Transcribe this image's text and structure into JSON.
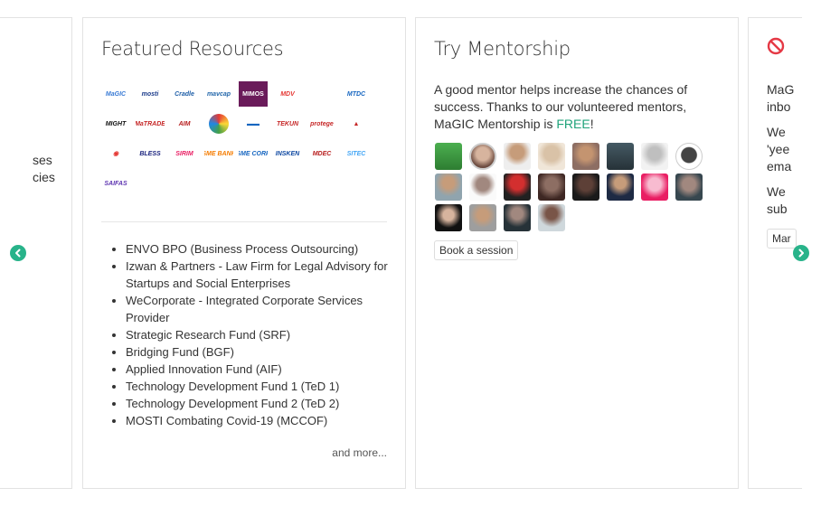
{
  "left_card": {
    "lines": [
      "ses",
      "cies"
    ]
  },
  "resources": {
    "title": "Featured Resources",
    "logos": [
      "MaGIC",
      "mosti",
      "Cradle",
      "mavcap",
      "MIMOS",
      "MDV",
      "",
      "MTDC",
      "MIGHT",
      "MaTRADE",
      "AIM",
      "",
      "",
      "TEKUN",
      "protege",
      "",
      "",
      "BLESS",
      "SIRIM",
      "SME BANK",
      "SME CORP",
      "INSKEN",
      "MDEC",
      "SITEC",
      "SAIFAS"
    ],
    "items": [
      "ENVO BPO (Business Process Outsourcing)",
      "Izwan & Partners - Law Firm for Legal Advisory for Startups and Social Enterprises",
      "WeCorporate - Integrated Corporate Services Provider",
      "Strategic Research Fund (SRF)",
      "Bridging Fund (BGF)",
      "Applied Innovation Fund (AIF)",
      "Technology Development Fund 1 (TeD 1)",
      "Technology Development Fund 2 (TeD 2)",
      "MOSTI Combating Covid-19 (MCCOF)"
    ],
    "more": "and more..."
  },
  "mentorship": {
    "title": "Try Mentorship",
    "desc_before": "A good mentor helps increase the chances of success. Thanks to our volunteered mentors, MaGIC Mentorship is ",
    "free": "FREE",
    "desc_after": "!",
    "button": "Book a session",
    "avatar_count": 20
  },
  "right_card": {
    "lines": [
      "MaG",
      "inbo",
      "We",
      "'yee",
      "ema",
      "We",
      "sub"
    ],
    "button": "Mar"
  },
  "colors": {
    "accent": "#28b38a",
    "free": "#1fa37a",
    "ban": "#e53945"
  },
  "icons": {
    "prev": "chevron-left-icon",
    "next": "chevron-right-icon",
    "ban": "ban-icon"
  }
}
